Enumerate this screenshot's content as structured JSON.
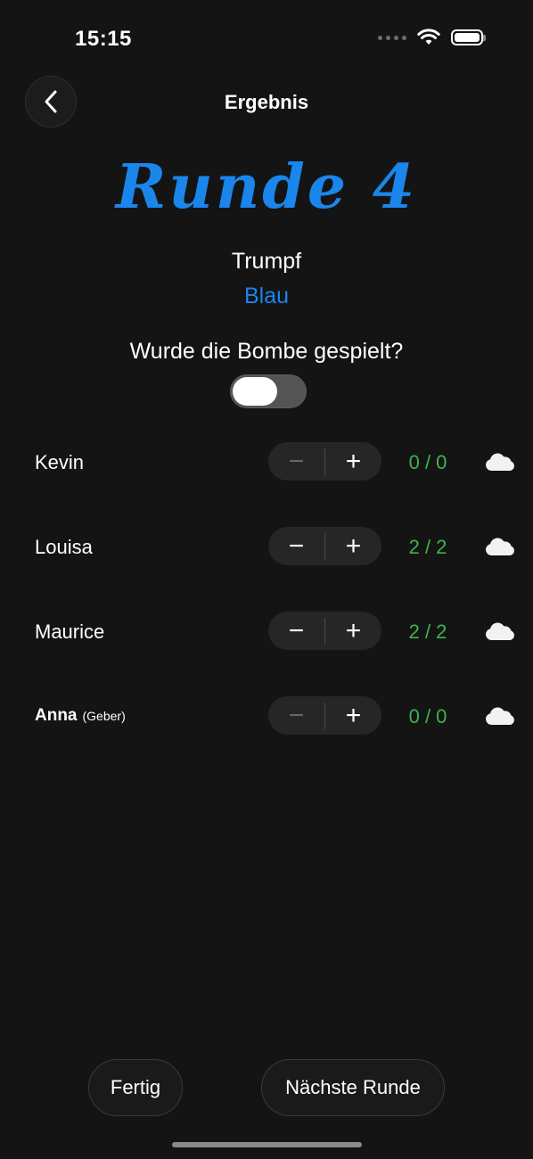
{
  "status_bar": {
    "time": "15:15"
  },
  "nav": {
    "title": "Ergebnis",
    "back_icon": "chevron-left-icon"
  },
  "round": {
    "title": "Runde 4"
  },
  "trump": {
    "label": "Trumpf",
    "value": "Blau",
    "value_color": "#1a86ec"
  },
  "bomb": {
    "question": "Wurde die Bombe gespielt?",
    "toggle_on": false
  },
  "players": [
    {
      "name": "Kevin",
      "note": "",
      "score": "0 / 0",
      "minus_enabled": false,
      "icon": "cloud-icon"
    },
    {
      "name": "Louisa",
      "note": "",
      "score": "2 / 2",
      "minus_enabled": true,
      "icon": "cloud-icon"
    },
    {
      "name": "Maurice",
      "note": "",
      "score": "2 / 2",
      "minus_enabled": true,
      "icon": "cloud-icon"
    },
    {
      "name": "Anna",
      "note": "(Geber)",
      "score": "0 / 0",
      "minus_enabled": false,
      "icon": "cloud-icon"
    }
  ],
  "stepper": {
    "minus_label": "−",
    "plus_label": "+"
  },
  "actions": {
    "done_label": "Fertig",
    "next_label": "Nächste Runde"
  },
  "colors": {
    "accent": "#1a86ec",
    "score": "#3cb54b",
    "background": "#141414"
  }
}
